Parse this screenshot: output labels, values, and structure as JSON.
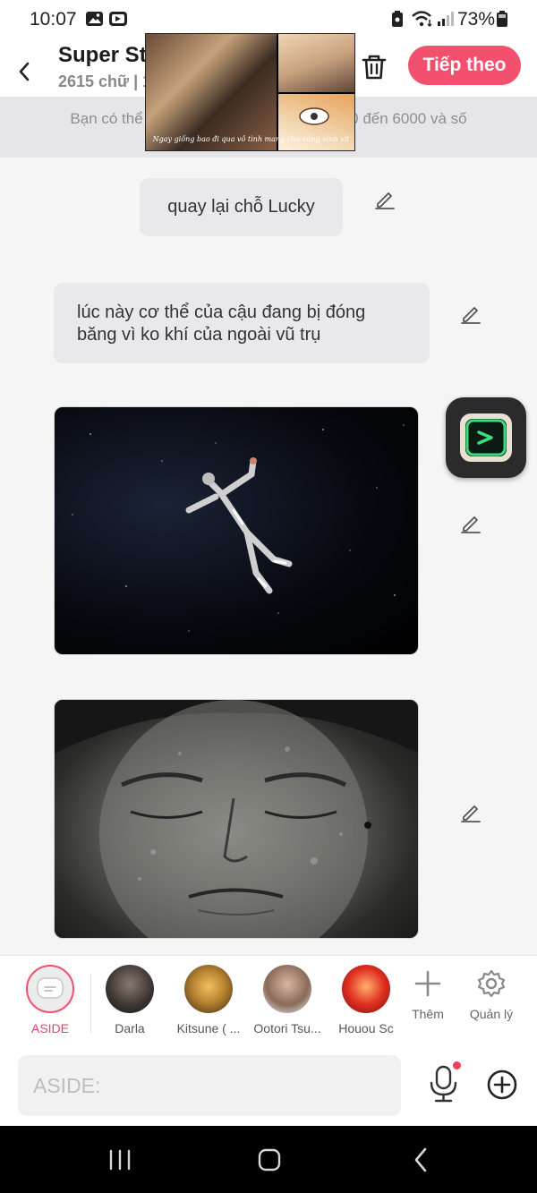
{
  "status_bar": {
    "time": "10:07",
    "battery_percent": "73%",
    "icons": [
      "gallery-icon",
      "screen-recorder-icon",
      "lock-icon",
      "wifi-icon",
      "signal-icon",
      "battery-icon"
    ]
  },
  "header": {
    "title": "Super Sta",
    "subtitle": "2615 chữ | 1",
    "next_label": "Tiếp theo",
    "accent_color": "#f2506e"
  },
  "notice": {
    "text": "Bạn có thể đă                                          00 đến 6000 và số",
    "text_line2": "0"
  },
  "pip_video": {
    "caption": "Ngay giống bao đi qua vô tình mang cho vùng xinh xít"
  },
  "chat": {
    "messages": [
      {
        "type": "text",
        "text": "quay lại chỗ Lucky"
      },
      {
        "type": "text",
        "text": "lúc này cơ thể của cậu đang bị đóng băng vì ko khí của ngoài vũ trụ"
      },
      {
        "type": "image",
        "subject": "astronaut floating in space"
      },
      {
        "type": "image",
        "subject": "frozen face close-up"
      }
    ]
  },
  "characters": [
    {
      "name": "ASIDE",
      "selected": true
    },
    {
      "name": "Darla"
    },
    {
      "name": "Kitsune ( ..."
    },
    {
      "name": "Ootori Tsu..."
    },
    {
      "name": "Houou Sc"
    }
  ],
  "tools": {
    "add_label": "Thêm",
    "manage_label": "Quản lý"
  },
  "input": {
    "placeholder": "ASIDE:"
  }
}
